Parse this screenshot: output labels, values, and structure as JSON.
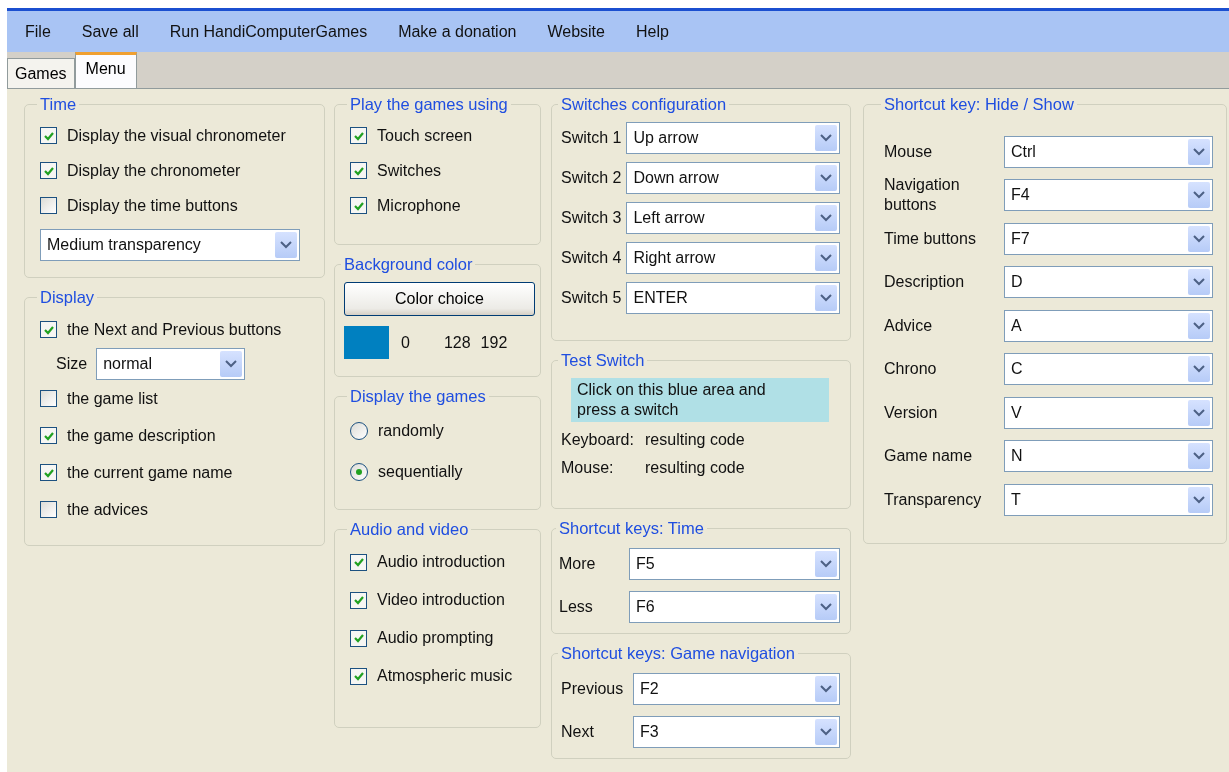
{
  "menu": [
    "File",
    "Save all",
    "Run HandiComputerGames",
    "Make a donation",
    "Website",
    "Help"
  ],
  "tabs": [
    {
      "label": "Games",
      "selected": false
    },
    {
      "label": "Menu",
      "selected": true
    }
  ],
  "time": {
    "title": "Time",
    "options": [
      {
        "label": "Display the visual chronometer",
        "checked": true
      },
      {
        "label": "Display the chronometer",
        "checked": true
      },
      {
        "label": "Display the time buttons",
        "checked": false
      }
    ],
    "transparency": "Medium transparency"
  },
  "display": {
    "title": "Display",
    "items": [
      {
        "kind": "checkbox",
        "label": "the Next and Previous buttons",
        "checked": true
      },
      {
        "kind": "select",
        "label": "Size",
        "value": "normal"
      },
      {
        "kind": "checkbox",
        "label": "the game list",
        "checked": false
      },
      {
        "kind": "checkbox",
        "label": "the game description",
        "checked": true
      },
      {
        "kind": "checkbox",
        "label": "the current game name",
        "checked": true
      },
      {
        "kind": "checkbox",
        "label": "the advices",
        "checked": false
      }
    ]
  },
  "play": {
    "title": "Play the games using",
    "options": [
      {
        "label": "Touch screen",
        "checked": true
      },
      {
        "label": "Switches",
        "checked": true
      },
      {
        "label": "Microphone",
        "checked": true
      }
    ]
  },
  "background": {
    "title": "Background color",
    "button": "Color choice",
    "values": [
      "0",
      "128",
      "192"
    ]
  },
  "display_games": {
    "title": "Display the games",
    "options": [
      {
        "label": "randomly",
        "selected": false
      },
      {
        "label": "sequentially",
        "selected": true
      }
    ]
  },
  "audio": {
    "title": "Audio and video",
    "options": [
      {
        "label": "Audio introduction",
        "checked": true
      },
      {
        "label": "Video introduction",
        "checked": true
      },
      {
        "label": "Audio prompting",
        "checked": true
      },
      {
        "label": "Atmospheric music",
        "checked": true
      }
    ]
  },
  "switches": {
    "title": "Switches configuration",
    "rows": [
      {
        "label": "Switch 1",
        "value": "Up arrow"
      },
      {
        "label": "Switch 2",
        "value": "Down arrow"
      },
      {
        "label": "Switch 3",
        "value": "Left arrow"
      },
      {
        "label": "Switch 4",
        "value": "Right arrow"
      },
      {
        "label": "Switch 5",
        "value": "ENTER"
      }
    ]
  },
  "test_switch": {
    "title": "Test Switch",
    "prompt": "Click on this blue area and press a switch",
    "rows": [
      {
        "label": "Keyboard:",
        "value": "resulting code"
      },
      {
        "label": "Mouse:",
        "value": "resulting code"
      }
    ]
  },
  "time_keys": {
    "title": "Shortcut keys: Time",
    "rows": [
      {
        "label": "More",
        "value": "F5"
      },
      {
        "label": "Less",
        "value": "F6"
      }
    ]
  },
  "nav_keys": {
    "title": "Shortcut keys: Game navigation",
    "rows": [
      {
        "label": "Previous",
        "value": "F2"
      },
      {
        "label": "Next",
        "value": "F3"
      }
    ]
  },
  "hide_show": {
    "title": "Shortcut key: Hide / Show",
    "rows": [
      {
        "label": "Mouse",
        "value": "Ctrl"
      },
      {
        "label": "Navigation buttons",
        "value": "F4"
      },
      {
        "label": "Time buttons",
        "value": "F7"
      },
      {
        "label": "Description",
        "value": "D"
      },
      {
        "label": "Advice",
        "value": "A"
      },
      {
        "label": "Chrono",
        "value": "C"
      },
      {
        "label": "Version",
        "value": "V"
      },
      {
        "label": "Game name",
        "value": "N"
      },
      {
        "label": "Transparency",
        "value": "T"
      }
    ]
  }
}
